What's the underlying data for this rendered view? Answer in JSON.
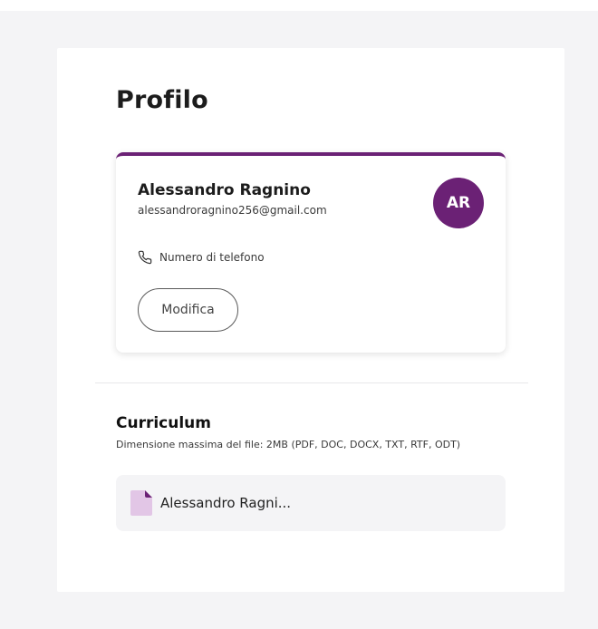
{
  "page": {
    "title": "Profilo"
  },
  "profile": {
    "name": "Alessandro Ragnino",
    "email": "alessandroragnino256@gmail.com",
    "avatar_initials": "AR",
    "phone_label": "Numero di telefono",
    "edit_label": "Modifica",
    "phone_icon": "phone-icon",
    "accent_color": "#6b2175"
  },
  "curriculum": {
    "title": "Curriculum",
    "subtitle": "Dimensione massima del file: 2MB (PDF, DOC, DOCX, TXT, RTF, ODT)",
    "file_name": "Alessandro Ragni...",
    "file_icon": "document-icon",
    "file_icon_color": "#e2c6e6"
  }
}
